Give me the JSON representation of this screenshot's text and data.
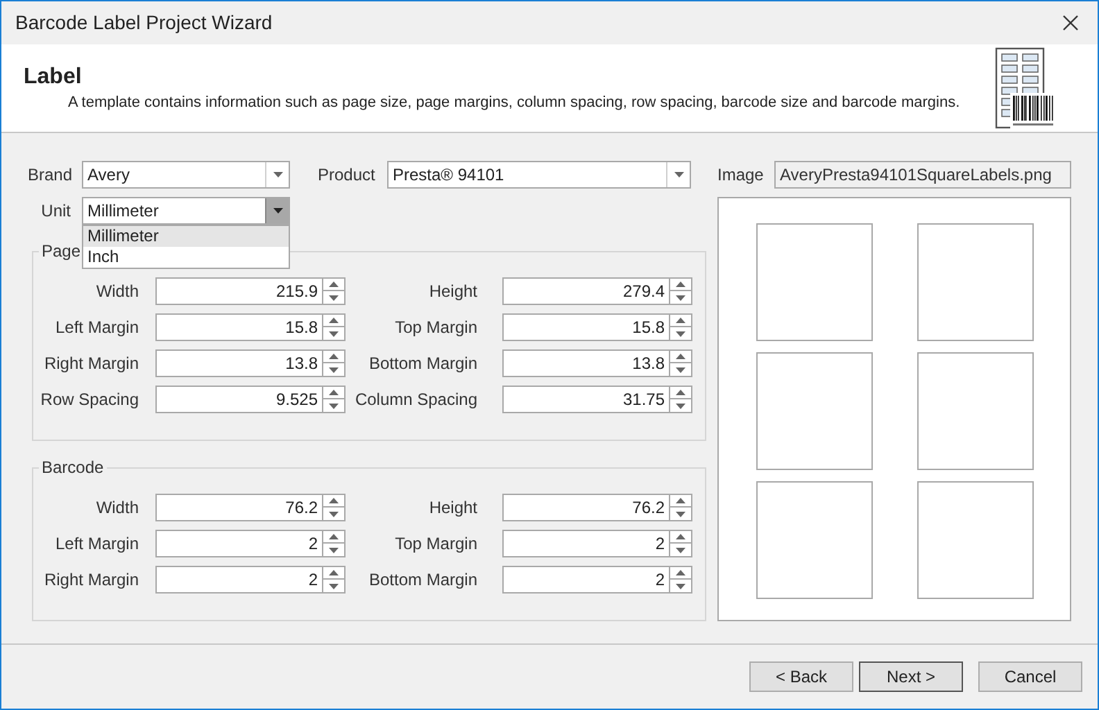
{
  "window": {
    "title": "Barcode Label Project Wizard"
  },
  "header": {
    "title": "Label",
    "description": "A template contains information such as page size, page margins, column spacing, row spacing, barcode size and barcode margins."
  },
  "brand": {
    "label": "Brand",
    "value": "Avery"
  },
  "product": {
    "label": "Product",
    "value": "Presta® 94101"
  },
  "unit": {
    "label": "Unit",
    "value": "Millimeter",
    "expanded": true,
    "options": [
      {
        "label": "Millimeter",
        "selected": true
      },
      {
        "label": "Inch",
        "selected": false
      }
    ]
  },
  "image": {
    "label": "Image",
    "value": "AveryPresta94101SquareLabels.png"
  },
  "groups": [
    {
      "title": "Page",
      "fields": [
        {
          "label": "Width",
          "value": "215.9"
        },
        {
          "label": "Height",
          "value": "279.4"
        },
        {
          "label": "Left Margin",
          "value": "15.8"
        },
        {
          "label": "Top Margin",
          "value": "15.8"
        },
        {
          "label": "Right Margin",
          "value": "13.8"
        },
        {
          "label": "Bottom Margin",
          "value": "13.8"
        },
        {
          "label": "Row Spacing",
          "value": "9.525"
        },
        {
          "label": "Column Spacing",
          "value": "31.75"
        }
      ]
    },
    {
      "title": "Barcode",
      "fields": [
        {
          "label": "Width",
          "value": "76.2"
        },
        {
          "label": "Height",
          "value": "76.2"
        },
        {
          "label": "Left Margin",
          "value": "2"
        },
        {
          "label": "Top Margin",
          "value": "2"
        },
        {
          "label": "Right Margin",
          "value": "2"
        },
        {
          "label": "Bottom Margin",
          "value": "2"
        }
      ]
    }
  ],
  "buttons": [
    {
      "label": "< Back",
      "default": false
    },
    {
      "label": "Next >",
      "default": true
    },
    {
      "label": "Cancel",
      "default": false
    }
  ]
}
